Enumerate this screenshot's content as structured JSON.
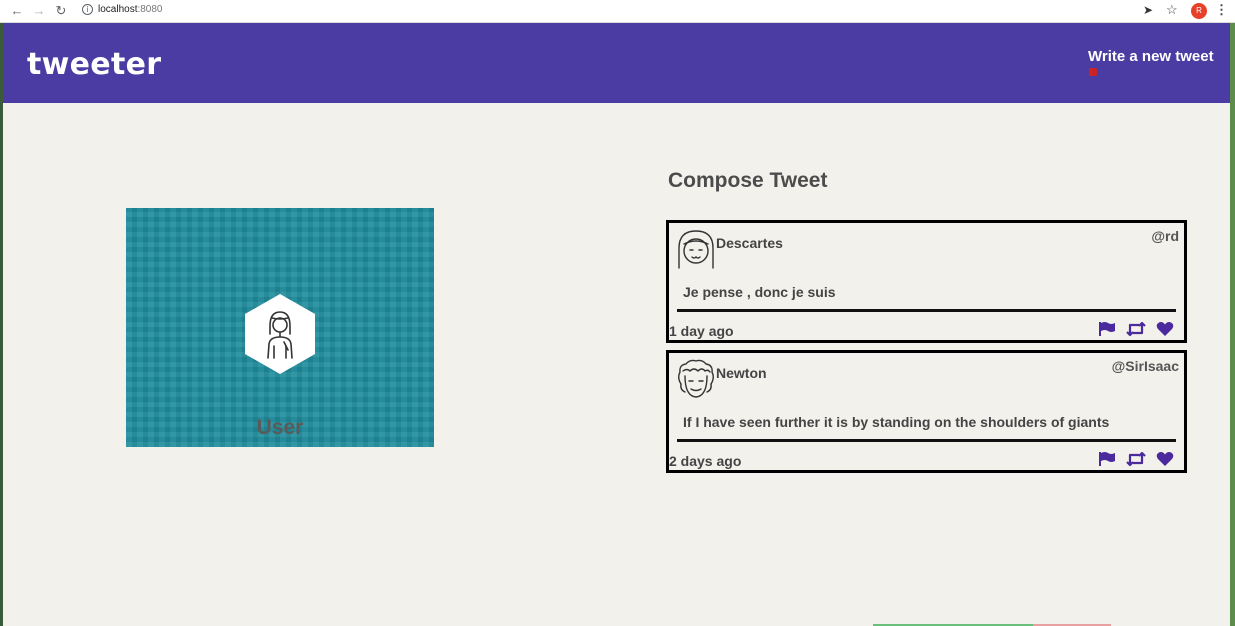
{
  "browser": {
    "url_host": "localhost",
    "url_port": ":8080",
    "profile_initial": "R"
  },
  "header": {
    "brand": "tweeter",
    "compose_link": "Write a new tweet"
  },
  "user_card": {
    "name": "User"
  },
  "compose": {
    "title": "Compose Tweet"
  },
  "tweets": [
    {
      "name": "Descartes",
      "handle": "@rd",
      "body": "Je pense , donc je suis",
      "time": "1 day ago"
    },
    {
      "name": "Newton",
      "handle": "@SirIsaac",
      "body": "If I have seen further it is by standing on the shoulders of giants",
      "time": "2 days ago"
    }
  ],
  "icons": {
    "flag": "flag-icon",
    "retweet": "retweet-icon",
    "like": "heart-icon"
  },
  "colors": {
    "header_bg": "#4a3ca3",
    "icon_purple": "#4a2a9c",
    "user_card_bg": "#1f8c9c"
  }
}
